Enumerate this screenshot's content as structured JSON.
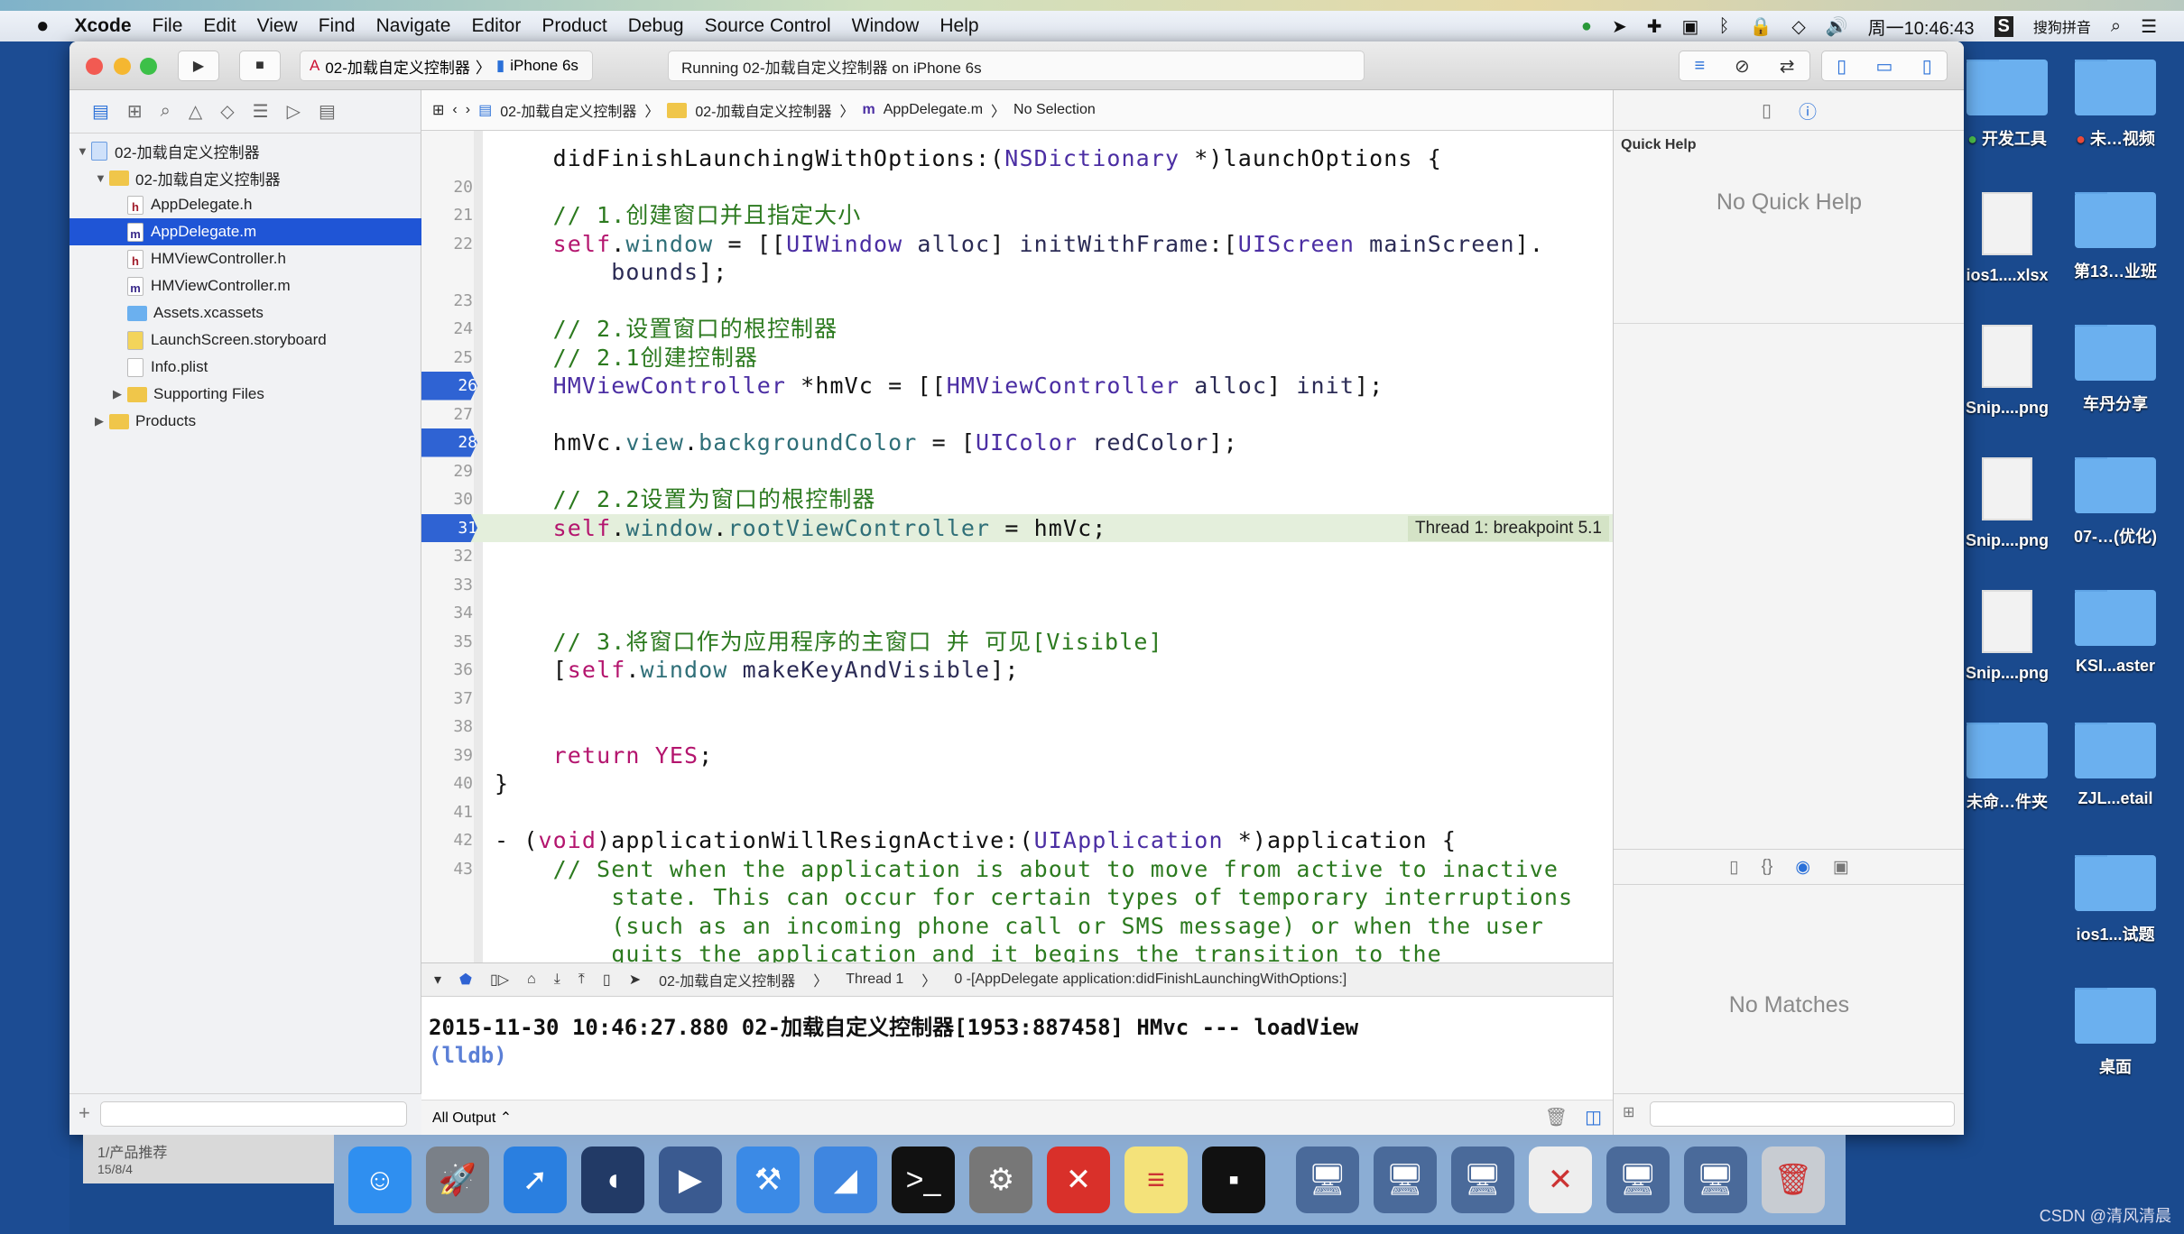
{
  "menubar": {
    "app": "Xcode",
    "items": [
      "File",
      "Edit",
      "View",
      "Find",
      "Navigate",
      "Editor",
      "Product",
      "Debug",
      "Source Control",
      "Window",
      "Help"
    ],
    "clock": "周一10:46:43",
    "ime": "搜狗拼音"
  },
  "toolbar": {
    "scheme": "02-加载自定义控制器",
    "device": "iPhone 6s",
    "activity": "Running 02-加载自定义控制器 on iPhone 6s"
  },
  "navigator": {
    "items": [
      {
        "label": "02-加载自定义控制器",
        "kind": "project",
        "level": 0,
        "open": true
      },
      {
        "label": "02-加载自定义控制器",
        "kind": "folder",
        "level": 1,
        "open": true
      },
      {
        "label": "AppDelegate.h",
        "kind": "h",
        "level": 2
      },
      {
        "label": "AppDelegate.m",
        "kind": "m",
        "level": 2,
        "selected": true
      },
      {
        "label": "HMViewController.h",
        "kind": "h",
        "level": 2
      },
      {
        "label": "HMViewController.m",
        "kind": "m",
        "level": 2
      },
      {
        "label": "Assets.xcassets",
        "kind": "assets",
        "level": 2
      },
      {
        "label": "LaunchScreen.storyboard",
        "kind": "storyboard",
        "level": 2
      },
      {
        "label": "Info.plist",
        "kind": "plist",
        "level": 2
      },
      {
        "label": "Supporting Files",
        "kind": "folder",
        "level": 2,
        "open": false
      },
      {
        "label": "Products",
        "kind": "folder",
        "level": 1,
        "open": false
      }
    ]
  },
  "jumpbar": {
    "project": "02-加载自定义控制器",
    "group": "02-加载自定义控制器",
    "file": "AppDelegate.m",
    "selection": "No Selection"
  },
  "editor": {
    "breakpoints": [
      "26",
      "28",
      "31"
    ],
    "current_line": "31",
    "thread_label": "Thread 1: breakpoint 5.1",
    "lines": [
      {
        "n": "",
        "s": [
          [
            "    didFinishLaunchingWithOptions:(",
            ""
          ],
          [
            "NSDictionary",
            "t"
          ],
          [
            " *)launchOptions {",
            ""
          ]
        ]
      },
      {
        "n": "20",
        "s": []
      },
      {
        "n": "21",
        "s": [
          [
            "    // 1.创建窗口并且指定大小",
            "c"
          ]
        ]
      },
      {
        "n": "22",
        "s": [
          [
            "    ",
            ""
          ],
          [
            "self",
            "k"
          ],
          [
            ".",
            ""
          ],
          [
            "window",
            "p"
          ],
          [
            " = [[",
            ""
          ],
          [
            "UIWindow",
            "t"
          ],
          [
            " alloc",
            "m"
          ],
          [
            "] ",
            ""
          ],
          [
            "initWithFrame",
            "m"
          ],
          [
            ":[",
            ""
          ],
          [
            "UIScreen",
            "t"
          ],
          [
            " mainScreen",
            "m"
          ],
          [
            "].",
            ""
          ]
        ]
      },
      {
        "n": "",
        "s": [
          [
            "        ",
            ""
          ],
          [
            "bounds",
            "m"
          ],
          [
            "];",
            ""
          ]
        ]
      },
      {
        "n": "23",
        "s": []
      },
      {
        "n": "24",
        "s": [
          [
            "    // 2.设置窗口的根控制器",
            "c"
          ]
        ]
      },
      {
        "n": "25",
        "s": [
          [
            "    // 2.1创建控制器",
            "c"
          ]
        ]
      },
      {
        "n": "26",
        "s": [
          [
            "    ",
            ""
          ],
          [
            "HMViewController",
            "t"
          ],
          [
            " *hmVc = [[",
            ""
          ],
          [
            "HMViewController",
            "t"
          ],
          [
            " alloc",
            "m"
          ],
          [
            "] ",
            ""
          ],
          [
            "init",
            "m"
          ],
          [
            "];",
            ""
          ]
        ]
      },
      {
        "n": "27",
        "s": []
      },
      {
        "n": "28",
        "s": [
          [
            "    hmVc.",
            ""
          ],
          [
            "view",
            "p"
          ],
          [
            ".",
            ""
          ],
          [
            "backgroundColor",
            "p"
          ],
          [
            " = [",
            ""
          ],
          [
            "UIColor",
            "t"
          ],
          [
            " redColor",
            "m"
          ],
          [
            "];",
            ""
          ]
        ]
      },
      {
        "n": "29",
        "s": []
      },
      {
        "n": "30",
        "s": [
          [
            "    // 2.2设置为窗口的根控制器",
            "c"
          ]
        ]
      },
      {
        "n": "31",
        "s": [
          [
            "    ",
            ""
          ],
          [
            "self",
            "k"
          ],
          [
            ".",
            ""
          ],
          [
            "window",
            "p"
          ],
          [
            ".",
            ""
          ],
          [
            "rootViewController",
            "p"
          ],
          [
            " = hmVc;",
            ""
          ]
        ]
      },
      {
        "n": "32",
        "s": []
      },
      {
        "n": "33",
        "s": []
      },
      {
        "n": "34",
        "s": []
      },
      {
        "n": "35",
        "s": [
          [
            "    // 3.将窗口作为应用程序的主窗口 并 可见[Visible]",
            "c"
          ]
        ]
      },
      {
        "n": "36",
        "s": [
          [
            "    [",
            ""
          ],
          [
            "self",
            "k"
          ],
          [
            ".",
            ""
          ],
          [
            "window",
            "p"
          ],
          [
            " makeKeyAndVisible",
            "m"
          ],
          [
            "];",
            ""
          ]
        ]
      },
      {
        "n": "37",
        "s": []
      },
      {
        "n": "38",
        "s": []
      },
      {
        "n": "39",
        "s": [
          [
            "    ",
            ""
          ],
          [
            "return",
            "k"
          ],
          [
            " ",
            ""
          ],
          [
            "YES",
            "k"
          ],
          [
            ";",
            ""
          ]
        ]
      },
      {
        "n": "40",
        "s": [
          [
            "}",
            ""
          ]
        ]
      },
      {
        "n": "41",
        "s": []
      },
      {
        "n": "42",
        "s": [
          [
            "- (",
            ""
          ],
          [
            "void",
            "k"
          ],
          [
            ")applicationWillResignActive:(",
            ""
          ],
          [
            "UIApplication",
            "t"
          ],
          [
            " *)application {",
            ""
          ]
        ]
      },
      {
        "n": "43",
        "s": [
          [
            "    // Sent when the application is about to move from active to inactive",
            "c"
          ]
        ]
      },
      {
        "n": "",
        "s": [
          [
            "        state. This can occur for certain types of temporary interruptions",
            "c"
          ]
        ]
      },
      {
        "n": "",
        "s": [
          [
            "        (such as an incoming phone call or SMS message) or when the user",
            "c"
          ]
        ]
      },
      {
        "n": "",
        "s": [
          [
            "        quits the application and it begins the transition to the",
            "c"
          ]
        ]
      }
    ]
  },
  "debugbar": {
    "target": "02-加载自定义控制器",
    "thread": "Thread 1",
    "frame": "0 -[AppDelegate application:didFinishLaunchingWithOptions:]"
  },
  "console": {
    "output": "2015-11-30 10:46:27.880 02-加载自定义控制器[1953:887458] HMvc --- loadView",
    "prompt": "(lldb)",
    "filter": "All Output ⌃"
  },
  "utilities": {
    "quick_help_title": "Quick Help",
    "quick_help_empty": "No Quick Help",
    "library_empty": "No Matches"
  },
  "desktop": {
    "items": [
      {
        "label": "开发工具",
        "type": "folder",
        "tag": "#4cbf4c"
      },
      {
        "label": "未…视频",
        "type": "folder",
        "tag": "#e84a3a"
      },
      {
        "label": "ios1....xlsx",
        "type": "doc"
      },
      {
        "label": "第13…业班",
        "type": "folder"
      },
      {
        "label": "Snip....png",
        "type": "doc"
      },
      {
        "label": "车丹分享",
        "type": "folder"
      },
      {
        "label": "Snip....png",
        "type": "doc"
      },
      {
        "label": "07-…(优化)",
        "type": "folder"
      },
      {
        "label": "Snip....png",
        "type": "doc"
      },
      {
        "label": "KSI...aster",
        "type": "folder"
      },
      {
        "label": "未命…件夹",
        "type": "folder"
      },
      {
        "label": "ZJL...etail",
        "type": "folder"
      },
      {
        "label": "",
        "type": "none"
      },
      {
        "label": "ios1...试题",
        "type": "folder"
      },
      {
        "label": "",
        "type": "none"
      },
      {
        "label": "桌面",
        "type": "folder"
      }
    ]
  },
  "dock": {
    "apps": [
      {
        "icon": "finder-icon",
        "color": "#2f8ff0",
        "glyph": "☺"
      },
      {
        "icon": "launchpad-icon",
        "color": "#7a8088",
        "glyph": "🚀"
      },
      {
        "icon": "safari-icon",
        "color": "#2a7fe0",
        "glyph": "➚"
      },
      {
        "icon": "mouse-app-icon",
        "color": "#223a66",
        "glyph": "◖"
      },
      {
        "icon": "video-app-icon",
        "color": "#3a5a90",
        "glyph": "▶"
      },
      {
        "icon": "xcode-icon",
        "color": "#3b8ae6",
        "glyph": "⚒"
      },
      {
        "icon": "instruments-icon",
        "color": "#3f86e0",
        "glyph": "◢"
      },
      {
        "icon": "terminal-icon",
        "color": "#111",
        "glyph": ">_"
      },
      {
        "icon": "system-preferences-icon",
        "color": "#777",
        "glyph": "⚙"
      },
      {
        "icon": "xmind-icon",
        "color": "#d9302a",
        "glyph": "✕"
      },
      {
        "icon": "notes-icon",
        "color": "#f4e27a",
        "glyph": "≡"
      },
      {
        "icon": "console-icon",
        "color": "#111",
        "glyph": "▪"
      },
      {
        "icon": "network-volume-icon",
        "color": "#4a6a9a",
        "glyph": "🖥"
      },
      {
        "icon": "network-volume-icon",
        "color": "#4a6a9a",
        "glyph": "🖥"
      },
      {
        "icon": "network-volume-icon",
        "color": "#4a6a9a",
        "glyph": "🖥"
      },
      {
        "icon": "document-icon",
        "color": "#eee",
        "glyph": "✕"
      },
      {
        "icon": "network-volume-icon",
        "color": "#4a6a9a",
        "glyph": "🖥"
      },
      {
        "icon": "network-volume-icon",
        "color": "#4a6a9a",
        "glyph": "🖥"
      },
      {
        "icon": "trash-icon",
        "color": "#c8ccd2",
        "glyph": "🗑"
      }
    ]
  },
  "notification": {
    "title": "1/产品推荐",
    "date": "15/8/4"
  },
  "watermark": "CSDN @清风清晨",
  "colors": {
    "selection": "#1f55d6",
    "breakpoint": "#2f63d3",
    "current_line": "#e4efdc",
    "desktop": "#1a4a8e"
  }
}
